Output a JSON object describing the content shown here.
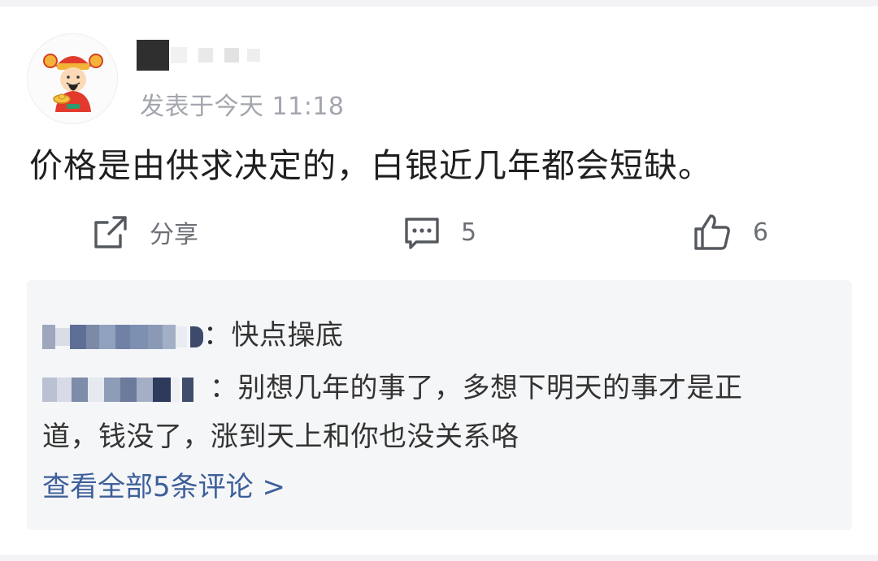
{
  "post": {
    "time": "发表于今天 11:18",
    "content": "价格是由供求决定的，白银近几年都会短缺。"
  },
  "actions": {
    "share_label": "分享",
    "comment_count": "5",
    "like_count": "6",
    "share_icon": "share-icon",
    "comment_icon": "comment-icon",
    "like_icon": "thumbs-up-icon"
  },
  "comments": {
    "items": [
      {
        "text": "：快点操底"
      },
      {
        "text": "：别想几年的事了，多想下明天的事才是正",
        "text_cont": "道，钱没了，涨到天上和你也没关系咯"
      }
    ],
    "view_all": "查看全部5条评论 >"
  },
  "colors": {
    "link": "#3d5f9a",
    "muted": "#a3a6ad",
    "comment_bg": "#f5f6f8"
  }
}
